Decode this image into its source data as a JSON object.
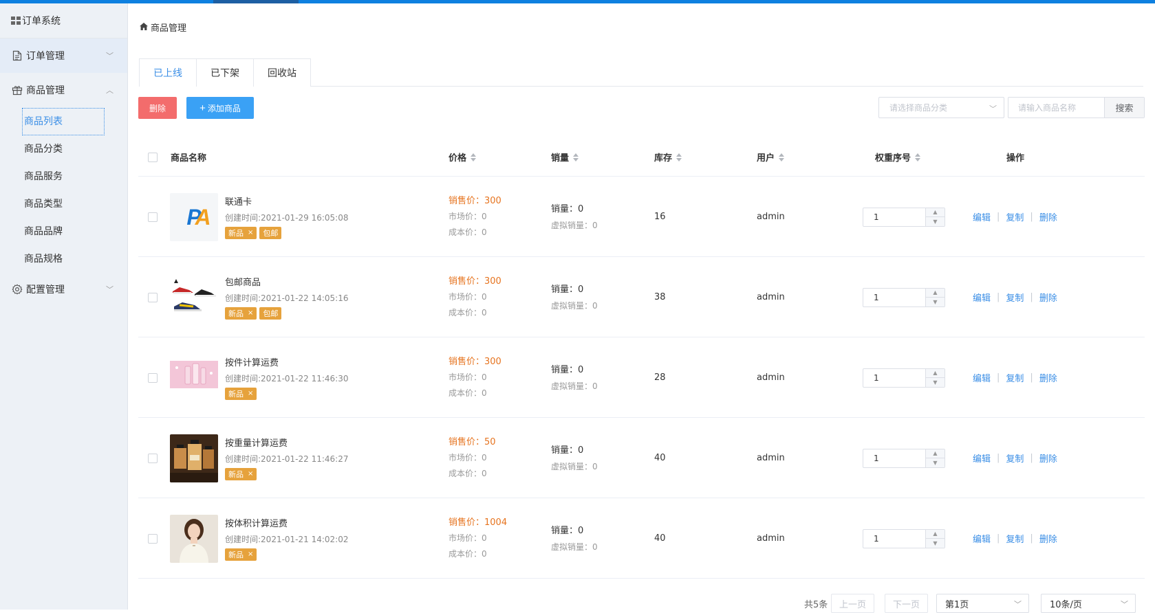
{
  "app": {
    "brand": "订单系统"
  },
  "sidebar": {
    "groups": [
      {
        "label": "订单管理",
        "icon": "document-icon",
        "expanded": false
      },
      {
        "label": "商品管理",
        "icon": "gift-icon",
        "expanded": true,
        "items": [
          "商品列表",
          "商品分类",
          "商品服务",
          "商品类型",
          "商品品牌",
          "商品规格"
        ]
      },
      {
        "label": "配置管理",
        "icon": "gear-icon",
        "expanded": false
      }
    ]
  },
  "breadcrumb": "商品管理",
  "tabs": [
    "已上线",
    "已下架",
    "回收站"
  ],
  "toolbar": {
    "delete_label": "删除",
    "add_label": "添加商品",
    "category_placeholder": "请选择商品分类",
    "search_placeholder": "请输入商品名称",
    "search_label": "搜索"
  },
  "table": {
    "headers": [
      "商品名称",
      "价格",
      "销量",
      "库存",
      "用户",
      "权重序号",
      "操作"
    ],
    "rows": [
      {
        "name": "联通卡",
        "date": "创建时间:2021-01-29 16:05:08",
        "tags": [
          "新品",
          "包邮"
        ],
        "sale_price": "销售价：300",
        "market_price": "市场价：0",
        "cost_price": "成本价：0",
        "sales": "销量：0",
        "virtual_sales": "虚拟销量：0",
        "stock": "16",
        "user": "admin",
        "weight": "1",
        "thumb": "pa-logo"
      },
      {
        "name": "包邮商品",
        "date": "创建时间:2021-01-22 14:05:16",
        "tags": [
          "新品",
          "包邮"
        ],
        "sale_price": "销售价：300",
        "market_price": "市场价：0",
        "cost_price": "成本价：0",
        "sales": "销量：0",
        "virtual_sales": "虚拟销量：0",
        "stock": "38",
        "user": "admin",
        "weight": "1",
        "thumb": "shoes"
      },
      {
        "name": "按件计算运费",
        "date": "创建时间:2021-01-22 11:46:30",
        "tags": [
          "新品"
        ],
        "sale_price": "销售价：300",
        "market_price": "市场价：0",
        "cost_price": "成本价：0",
        "sales": "销量：0",
        "virtual_sales": "虚拟销量：0",
        "stock": "28",
        "user": "admin",
        "weight": "1",
        "thumb": "pink-bottles"
      },
      {
        "name": "按重量计算运费",
        "date": "创建时间:2021-01-22 11:46:27",
        "tags": [
          "新品"
        ],
        "sale_price": "销售价：50",
        "market_price": "市场价：0",
        "cost_price": "成本价：0",
        "sales": "销量：0",
        "virtual_sales": "虚拟销量：0",
        "stock": "40",
        "user": "admin",
        "weight": "1",
        "thumb": "perfume"
      },
      {
        "name": "按体积计算运费",
        "date": "创建时间:2021-01-21 14:02:02",
        "tags": [
          "新品"
        ],
        "sale_price": "销售价：1004",
        "market_price": "市场价：0",
        "cost_price": "成本价：0",
        "sales": "销量：0",
        "virtual_sales": "虚拟销量：0",
        "stock": "40",
        "user": "admin",
        "weight": "1",
        "thumb": "woman"
      }
    ],
    "actions": [
      "编辑",
      "复制",
      "删除"
    ]
  },
  "pagination": {
    "total": "共5条",
    "prev": "上一页",
    "next": "下一页",
    "page": "第1页",
    "page_size": "10条/页"
  },
  "colors": {
    "accent": "#3a8ee6",
    "danger": "#f36c6c",
    "primary": "#3aa1f5",
    "tag": "#e6a23c",
    "price": "#e6731e"
  }
}
